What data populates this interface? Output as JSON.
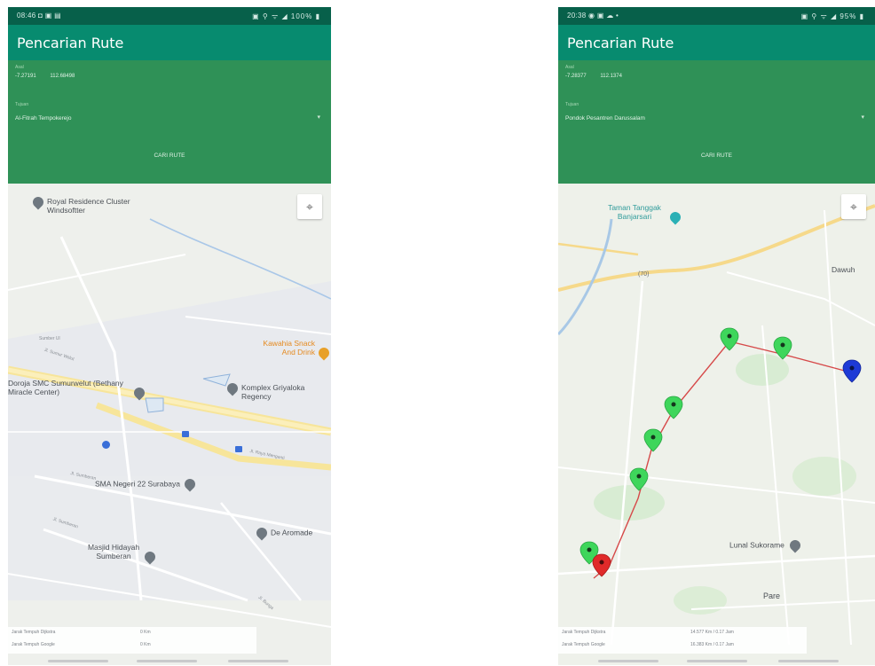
{
  "left": {
    "status": {
      "time": "08:46 ◘ ▣ ▤",
      "icons": "▣ ⚲ ᯤ ◢ 100% ▮"
    },
    "app_title": "Pencarian Rute",
    "origin_label": "Asal",
    "origin": {
      "lat": "-7.27191",
      "lng": "112.68498"
    },
    "dest_label": "Tujuan",
    "destination": "Al-Fitrah Tempokerejo",
    "search_label": "CARI RUTE",
    "locate_icon": "crosshair-icon",
    "pois": [
      "Royal Residence Cluster Windsoftter",
      "Kawahia Snack And Drink",
      "Doroja SMC Sumurwelut (Bethany Miracle Center)",
      "Komplex Griyaloka Regency",
      "SMA Negeri 22 Surabaya",
      "De Aromade",
      "Masjid Hidayah Sumberan"
    ],
    "streets": [
      "Sumber Ul",
      "Jl. Sumur Welut",
      "Jl. Raya Menganti",
      "Jl. Sumberan",
      "Jl. Sumberan",
      "Jl. Bunga"
    ],
    "distance": {
      "label": "Jarak Tempuh Dijkstra",
      "value": "0 Km"
    },
    "google": {
      "label": "Jarak Tempuh Google",
      "value": "0 Km"
    }
  },
  "right": {
    "status": {
      "time": "20:38 ◉ ▣ ☁ •",
      "icons": "▣ ⚲ ᯤ ◢ 95% ▮"
    },
    "app_title": "Pencarian Rute",
    "origin_label": "Asal",
    "origin": {
      "lat": "-7.28377",
      "lng": "112.1374"
    },
    "dest_label": "Tujuan",
    "destination": "Pondok Pesantren Darussalam",
    "search_label": "CARI RUTE",
    "locate_icon": "crosshair-icon",
    "pois": [
      "Taman Tanggak Banjarsari",
      "Dawuh",
      "Lunal Sukorame",
      "Pare"
    ],
    "road_badge": "(70)",
    "route_markers": {
      "green": 6,
      "blue": 1,
      "red": 1,
      "colors": {
        "green": "#3ed65b",
        "blue": "#1e3ad6",
        "red": "#e02a2a",
        "route": "#d64949"
      }
    },
    "distance": {
      "label": "Jarak Tempuh Dijkstra",
      "value": "14.577 Km / 0.17 Jam"
    },
    "google": {
      "label": "Jarak Tempuh Google",
      "value": "16.383 Km / 0.17 Jam"
    }
  }
}
